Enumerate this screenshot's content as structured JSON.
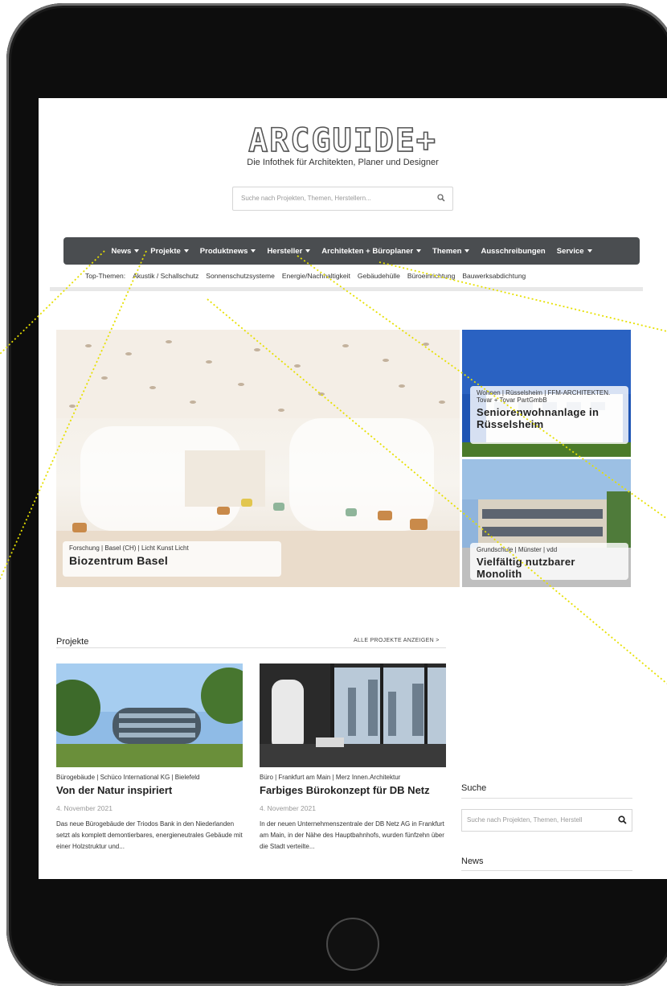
{
  "header": {
    "logo": "ARCGUIDE+",
    "tagline": "Die Infothek für Architekten, Planer und Designer",
    "search_placeholder": "Suche nach Projekten, Themen, Herstellern..."
  },
  "nav": {
    "items": [
      {
        "label": "News"
      },
      {
        "label": "Projekte"
      },
      {
        "label": "Produktnews"
      },
      {
        "label": "Hersteller"
      },
      {
        "label": "Architekten + Büroplaner"
      },
      {
        "label": "Themen"
      },
      {
        "label": "Ausschreibungen"
      },
      {
        "label": "Service"
      }
    ]
  },
  "top_themes": {
    "label": "Top-Themen:",
    "items": [
      "Akustik / Schallschutz",
      "Sonnenschutzsysteme",
      "Energie/Nachhaltigkeit",
      "Gebäudehülle",
      "Büroeinrichtung",
      "Bauwerksabdichtung"
    ]
  },
  "hero": {
    "main": {
      "meta": "Forschung | Basel (CH) | Licht Kunst Licht",
      "title": "Biozentrum Basel"
    },
    "side1": {
      "meta": "Wohnen | Rüsselsheim | FFM-ARCHITEKTEN. Tovar + Tovar PartGmbB",
      "title": "Seniorenwohnanlage in Rüsselsheim"
    },
    "side2": {
      "meta": "Grundschule | Münster | vdd",
      "title": "Vielfältig nutzbarer Monolith"
    }
  },
  "projects": {
    "title": "Projekte",
    "link": "ALLE PROJEKTE ANZEIGEN  >",
    "cards": [
      {
        "meta": "Bürogebäude | Schüco International KG | Bielefeld",
        "title": "Von der Natur inspiriert",
        "date": "4. November 2021",
        "excerpt": "Das neue Bürogebäude der Triodos Bank in den Niederlanden setzt als komplett demontierbares, energieneutrales Gebäude mit einer Holzstruktur und..."
      },
      {
        "meta": "Büro | Frankfurt am Main | Merz Innen.Architektur",
        "title": "Farbiges Bürokonzept für DB Netz",
        "date": "4. November 2021",
        "excerpt": "In der neuen Unternehmenszentrale der DB Netz AG in Frankfurt am Main, in der Nähe des Hauptbahnhofs, wurden fünfzehn über die Stadt verteilte..."
      }
    ]
  },
  "sidebar": {
    "search_title": "Suche",
    "search_placeholder": "Suche nach Projekten, Themen, Herstell",
    "news_title": "News"
  },
  "colors": {
    "nav_bg": "#4a4d50",
    "callout": "#e6e000"
  }
}
